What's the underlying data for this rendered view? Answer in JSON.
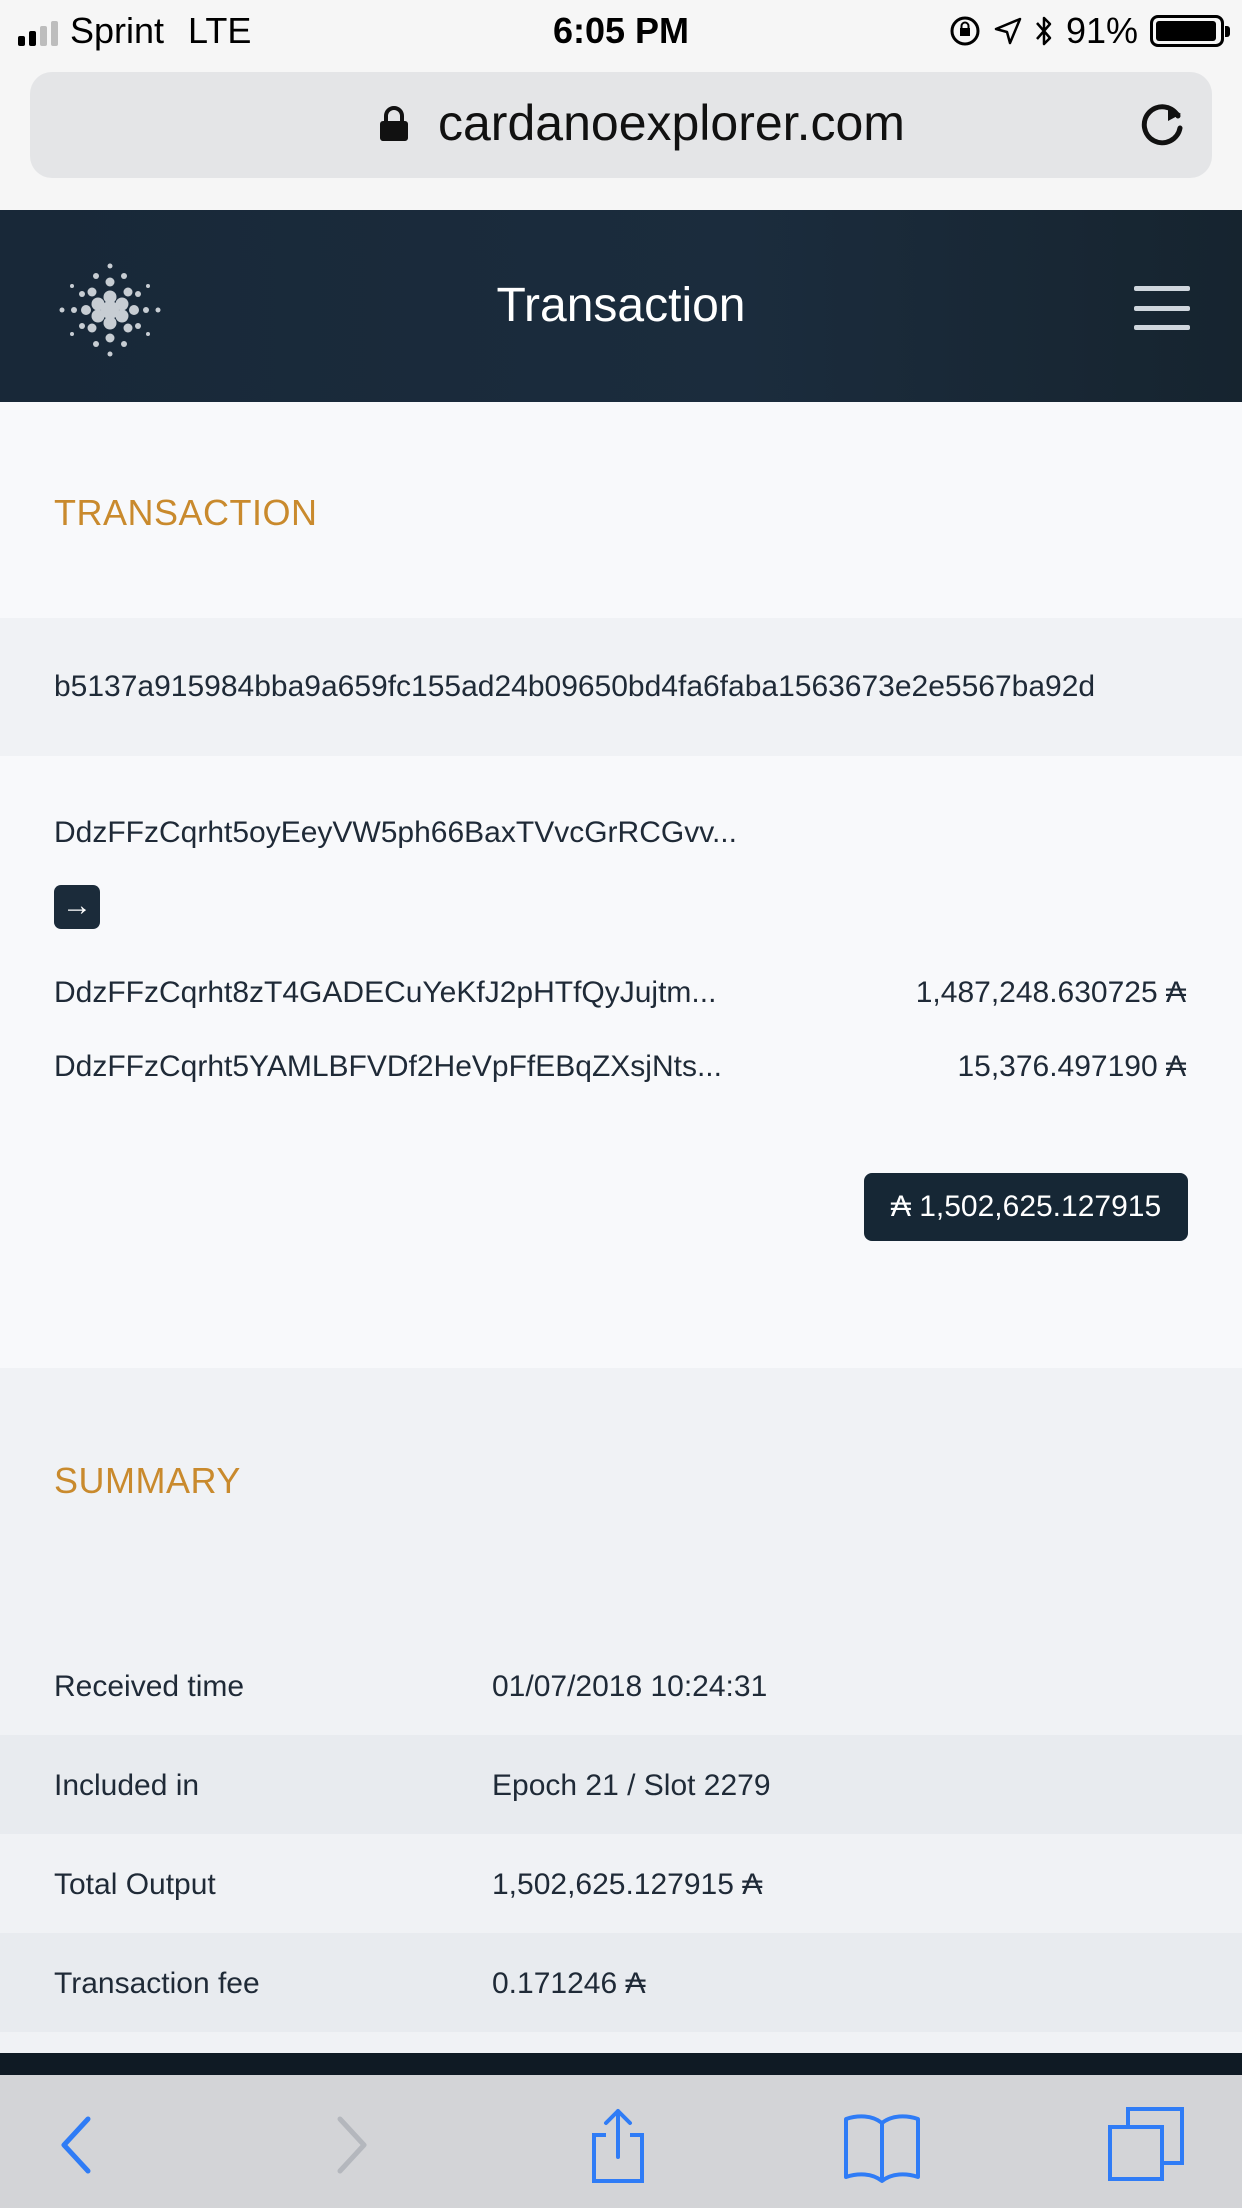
{
  "status_bar": {
    "carrier": "Sprint",
    "network": "LTE",
    "time": "6:05 PM",
    "battery_percent": "91%",
    "battery_level": 0.91
  },
  "browser": {
    "url": "cardanoexplorer.com"
  },
  "header": {
    "title": "Transaction"
  },
  "transaction": {
    "section_title": "TRANSACTION",
    "hash": "b5137a915984bba9a659fc155ad24b09650bd4fa6faba1563673e2e5567ba92d",
    "input_address": "DdzFFzCqrht5oyEeyVW5ph66BaxTVvcGrRCGvv...",
    "outputs": [
      {
        "address": "DdzFFzCqrht8zT4GADECuYeKfJ2pHTfQyJujtm...",
        "amount": "1,487,248.630725 ₳"
      },
      {
        "address": "DdzFFzCqrht5YAMLBFVDf2HeVpFfEBqZXsjNts...",
        "amount": "15,376.497190 ₳"
      }
    ],
    "total": "₳  1,502,625.127915"
  },
  "summary": {
    "section_title": "SUMMARY",
    "rows": [
      {
        "label": "Received time",
        "value": "01/07/2018 10:24:31"
      },
      {
        "label": "Included in",
        "value": "Epoch 21 / Slot 2279"
      },
      {
        "label": "Total Output",
        "value": "1,502,625.127915 ₳"
      },
      {
        "label": "Transaction fee",
        "value": "0.171246 ₳"
      }
    ]
  },
  "colors": {
    "accent": "#c98a2d",
    "header_bg": "#182838",
    "ios_blue": "#2f7cf6"
  },
  "icons": [
    "lock-icon",
    "reload-icon",
    "cardano-logo-icon",
    "menu-icon",
    "arrow-right-icon",
    "back-icon",
    "forward-icon",
    "share-icon",
    "bookmarks-icon",
    "tabs-icon"
  ]
}
